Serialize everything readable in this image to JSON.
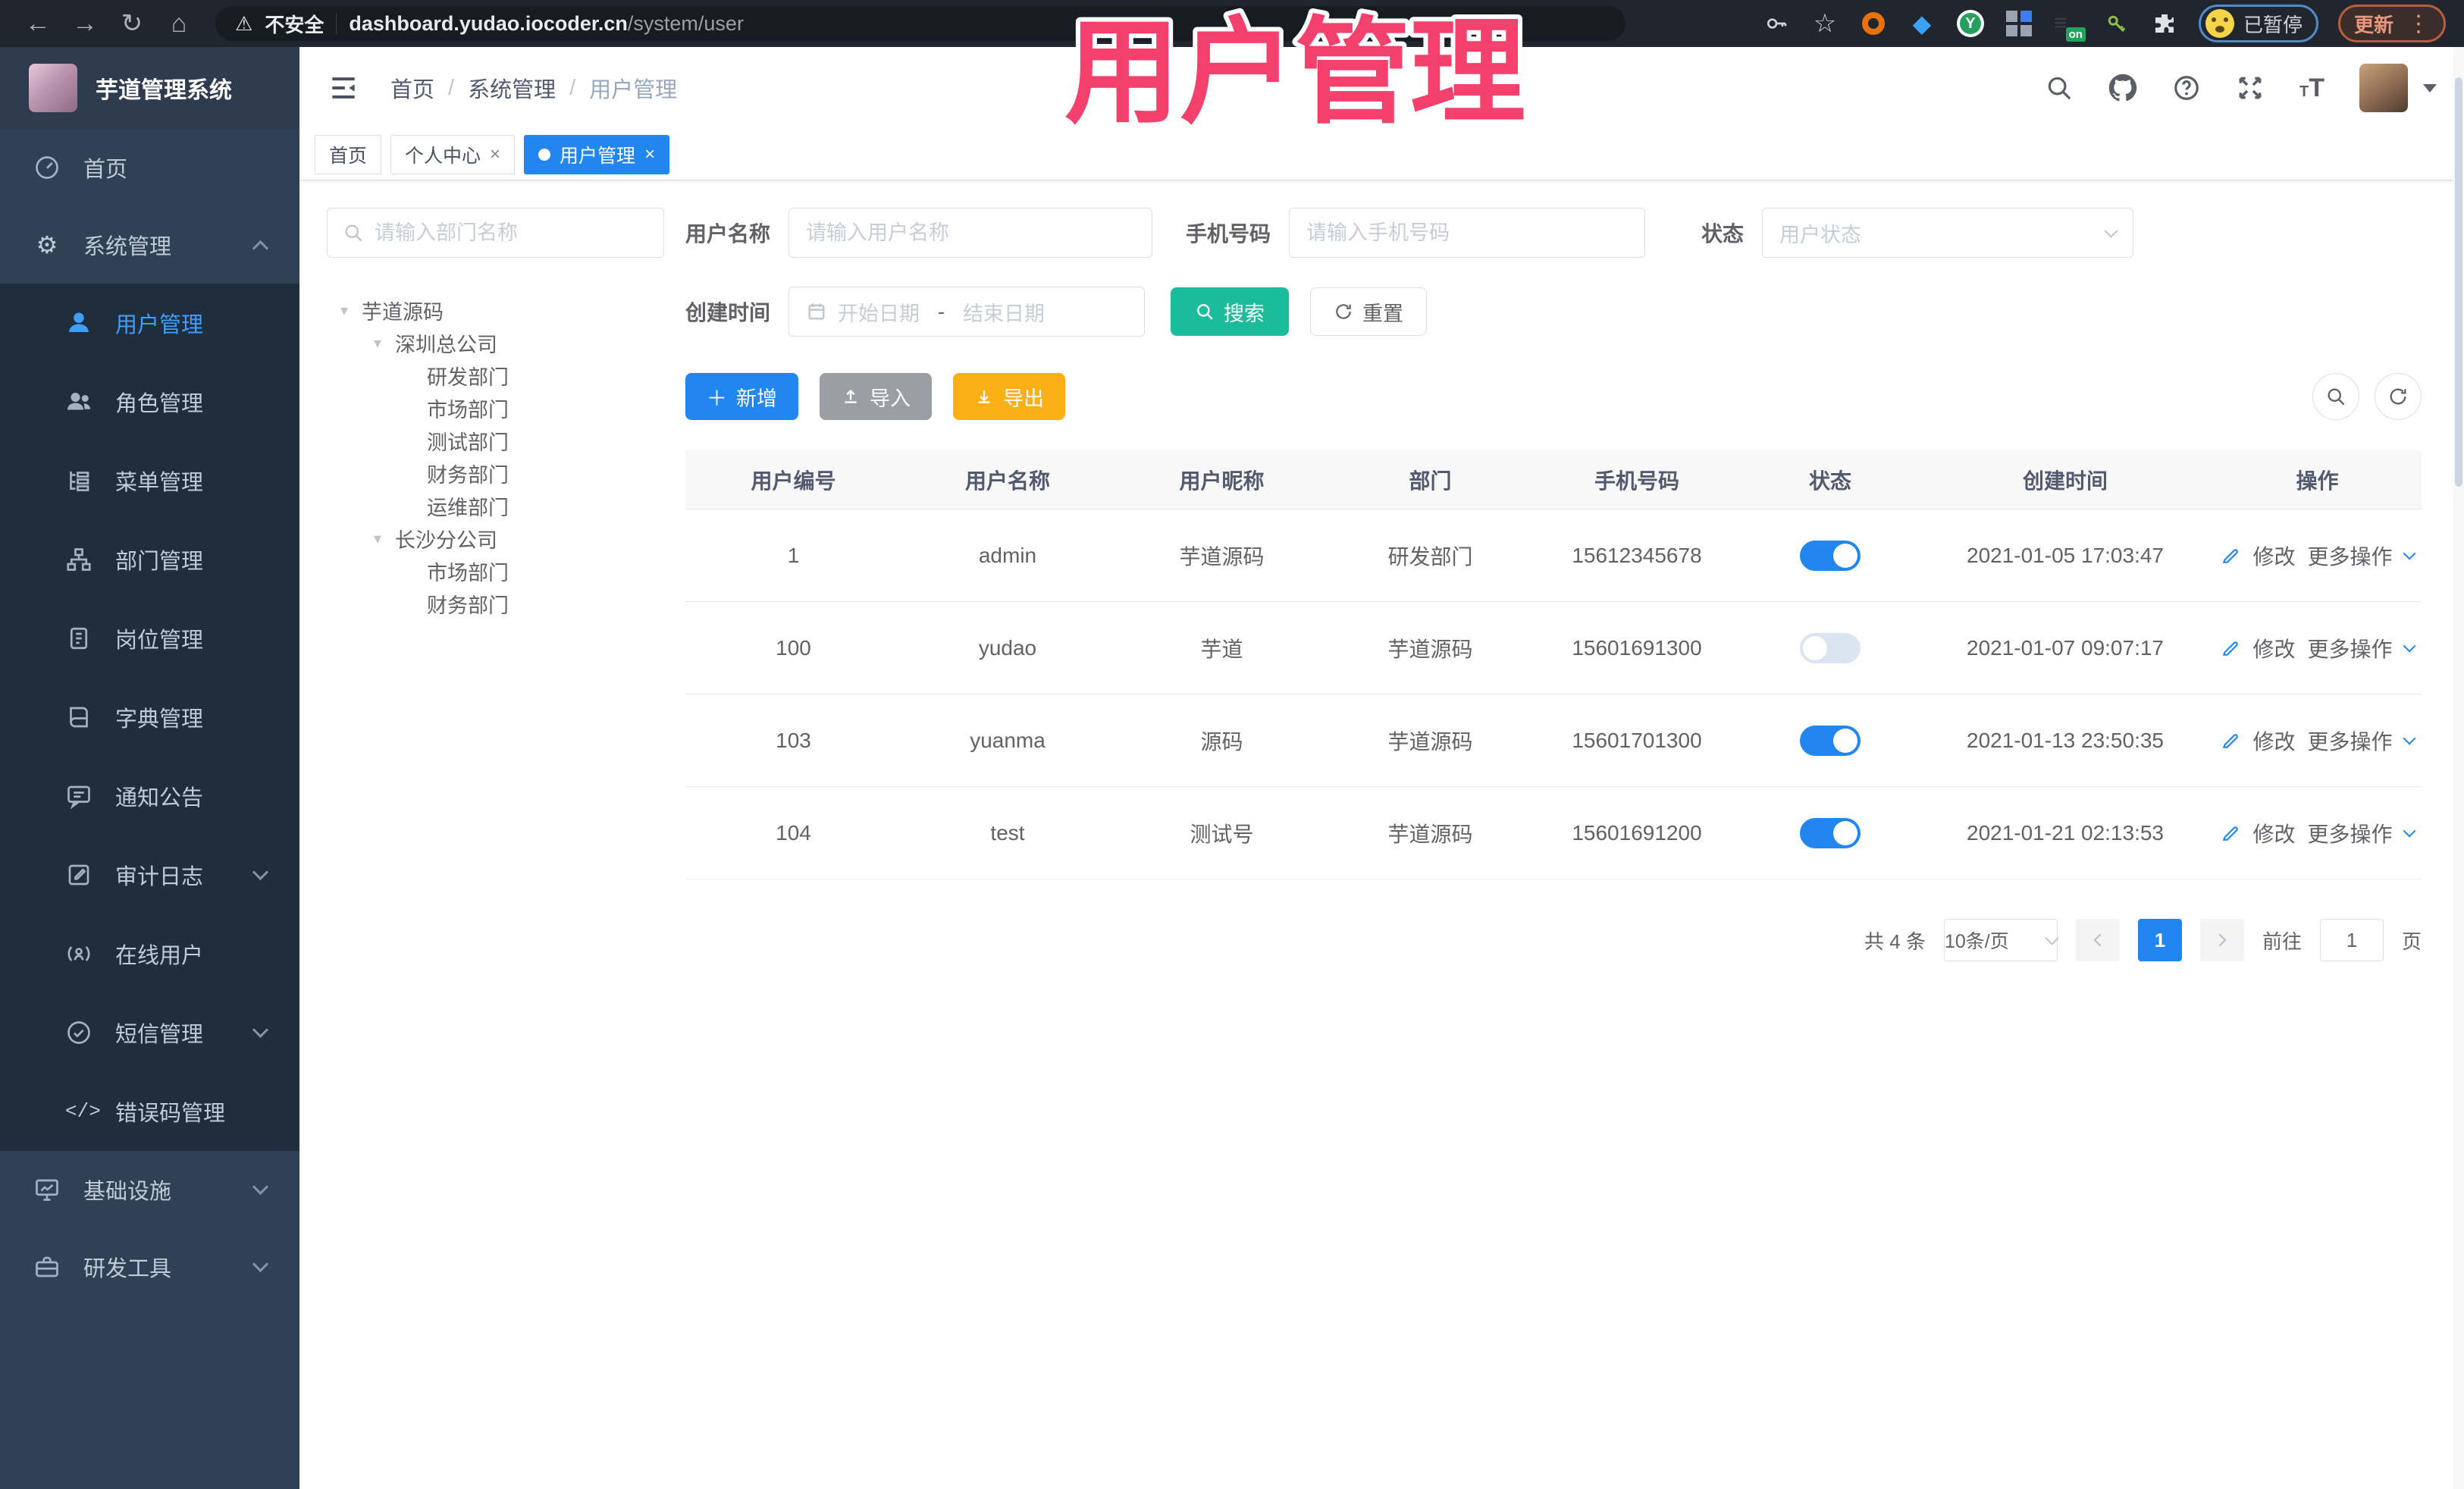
{
  "browser": {
    "security_label": "不安全",
    "url_host": "dashboard.yudao.iocoder.cn",
    "url_path": "/system/user",
    "paused_badge": "已暂停",
    "update_button": "更新"
  },
  "overlay_title": "用户管理",
  "colors": {
    "accent_blue": "#2186f0",
    "teal_search": "#1abc9c",
    "export_orange": "#fdb016",
    "import_gray": "#9c9ea6",
    "sidebar_bg": "#304156",
    "submenu_bg": "#1f2d3d",
    "active_menu_text": "#409eff",
    "overlay_pink": "#f4406d"
  },
  "app": {
    "logo_title": "芋道管理系统",
    "breadcrumb": [
      {
        "label": "首页"
      },
      {
        "label": "系统管理"
      },
      {
        "label": "用户管理"
      }
    ],
    "tabs": [
      {
        "label": "首页"
      },
      {
        "label": "个人中心",
        "close": "×"
      },
      {
        "label": "用户管理",
        "close": "×"
      }
    ]
  },
  "sidebar": {
    "items": [
      {
        "label": "首页"
      },
      {
        "label": "系统管理"
      },
      {
        "label": "用户管理"
      },
      {
        "label": "角色管理"
      },
      {
        "label": "菜单管理"
      },
      {
        "label": "部门管理"
      },
      {
        "label": "岗位管理"
      },
      {
        "label": "字典管理"
      },
      {
        "label": "通知公告"
      },
      {
        "label": "审计日志"
      },
      {
        "label": "在线用户"
      },
      {
        "label": "短信管理"
      },
      {
        "label": "错误码管理"
      },
      {
        "label": "基础设施"
      },
      {
        "label": "研发工具"
      }
    ]
  },
  "tree": {
    "search_placeholder": "请输入部门名称",
    "nodes": [
      {
        "label": "芋道源码"
      },
      {
        "label": "深圳总公司"
      },
      {
        "label": "研发部门"
      },
      {
        "label": "市场部门"
      },
      {
        "label": "测试部门"
      },
      {
        "label": "财务部门"
      },
      {
        "label": "运维部门"
      },
      {
        "label": "长沙分公司"
      },
      {
        "label": "市场部门"
      },
      {
        "label": "财务部门"
      }
    ]
  },
  "filters": {
    "username_label": "用户名称",
    "username_placeholder": "请输入用户名称",
    "mobile_label": "手机号码",
    "mobile_placeholder": "请输入手机号码",
    "status_label": "状态",
    "status_placeholder": "用户状态",
    "create_time_label": "创建时间",
    "date_start_placeholder": "开始日期",
    "date_separator": "-",
    "date_end_placeholder": "结束日期",
    "search_button": "搜索",
    "reset_button": "重置"
  },
  "toolbar": {
    "add_label": "新增",
    "import_label": "导入",
    "export_label": "导出"
  },
  "table": {
    "headers": [
      "用户编号",
      "用户名称",
      "用户昵称",
      "部门",
      "手机号码",
      "状态",
      "创建时间",
      "操作"
    ],
    "edit_label": "修改",
    "more_label": "更多操作",
    "rows": [
      {
        "id": "1",
        "username": "admin",
        "nickname": "芋道源码",
        "dept": "研发部门",
        "mobile": "15612345678",
        "created": "2021-01-05 17:03:47"
      },
      {
        "id": "100",
        "username": "yudao",
        "nickname": "芋道",
        "dept": "芋道源码",
        "mobile": "15601691300",
        "created": "2021-01-07 09:07:17"
      },
      {
        "id": "103",
        "username": "yuanma",
        "nickname": "源码",
        "dept": "芋道源码",
        "mobile": "15601701300",
        "created": "2021-01-13 23:50:35"
      },
      {
        "id": "104",
        "username": "test",
        "nickname": "测试号",
        "dept": "芋道源码",
        "mobile": "15601691200",
        "created": "2021-01-21 02:13:53"
      }
    ]
  },
  "pagination": {
    "total": "共 4 条",
    "page_size": "10条/页",
    "current_page": "1",
    "goto_label": "前往",
    "goto_value": "1",
    "page_label": "页"
  }
}
